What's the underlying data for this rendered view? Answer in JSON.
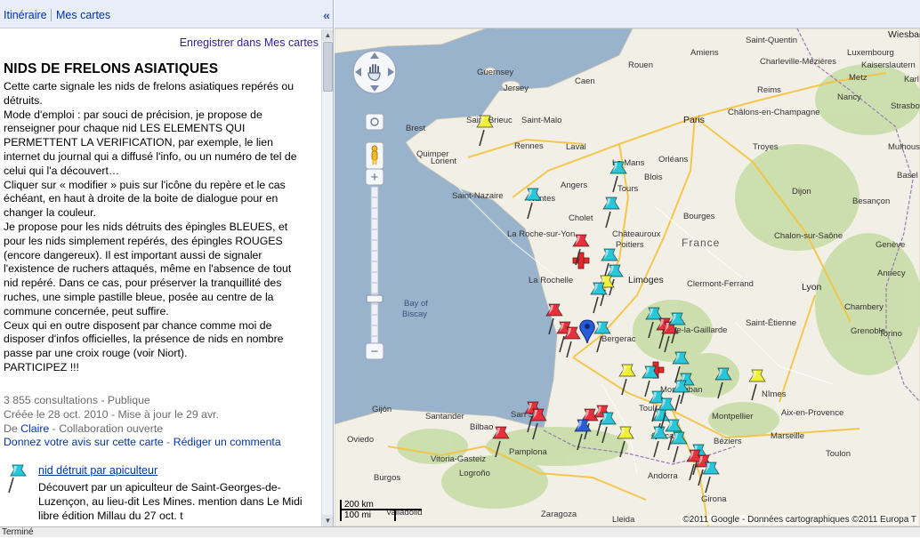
{
  "sidebar": {
    "tabs": [
      {
        "label": "Itinéraire"
      },
      {
        "label": "Mes cartes"
      }
    ],
    "collapse_label": "«",
    "save_label": "Enregistrer dans Mes cartes",
    "title": "NIDS DE FRELONS ASIATIQUES",
    "description": [
      "Cette carte signale les nids de frelons asiatiques repérés ou détruits.",
      "Mode d'emploi : par souci de précision, je propose de renseigner pour chaque nid LES ELEMENTS QUI PERMETTENT LA VERIFICATION, par exemple, le lien internet du journal qui a diffusé l'info, ou un numéro de tel de celui qui l'a découvert…",
      "Cliquer sur « modifier » puis sur l'icône du repère et le cas échéant, en haut à droite de la boite de dialogue pour en changer la couleur.",
      "Je propose pour les nids détruits des épingles BLEUES, et pour les nids simplement repérés, des épingles ROUGES (encore dangereux). Il est important aussi de signaler l'existence de ruchers attaqués, même en l'absence de tout nid repéré. Dans ce cas, pour préserver la tranquillité des ruches, une simple pastille bleue, posée au centre de la commune concernée, peut suffire.",
      "Ceux qui en outre disposent par chance comme moi de disposer d'infos officielles, la présence de nids en nombre passe par une croix rouge (voir Niort).",
      "PARTICIPEZ !!!"
    ],
    "meta": {
      "views": "3 855 consultations - Publique",
      "dates": "Créée le 28 oct. 2010 - Mise à jour le 29 avr.",
      "author_prefix": "De ",
      "author": "Claire",
      "collab": " - Collaboration ouverte",
      "feedback_link": "Donnez votre avis sur cette carte",
      "feedback_sep": " - ",
      "comment_link": "Rédiger un commenta"
    },
    "placemark": {
      "title": "nid détruit par apiculteur",
      "description": "Découvert par un apiculteur de Saint-Georges-de-Luzençon, au lieu-dit Les Mines. mention dans Le Midi libre édition Millau du 27 oct. t"
    }
  },
  "map": {
    "places": {
      "wiesbaden": "Wiesbad",
      "sq": "Saint-Quentin",
      "lux": "Luxembourg",
      "chm": "Charleville-Mézières",
      "kais": "Kaiserslautern",
      "amiens": "Amiens",
      "metz": "Metz",
      "karls": "Karl",
      "guern": "Guernsey",
      "rouen": "Rouen",
      "jersey": "Jersey",
      "caen": "Caen",
      "nancy": "Nancy",
      "stras": "Strasbourg",
      "reims": "Reims",
      "paris": "Paris",
      "chalons": "Châlons-en-Champagne",
      "brest": "Brest",
      "sb": "Saint-Brieuc",
      "sm": "Saint-Malo",
      "rennes": "Rennes",
      "laval": "Laval",
      "troyes": "Troyes",
      "mulh": "Mulhouse",
      "quimper": "Quimper",
      "lorient": "Lorient",
      "lemans": "Le Mans",
      "orleans": "Orléans",
      "basel": "Basel",
      "sn": "Saint-Nazaire",
      "angers": "Angers",
      "tours": "Tours",
      "blois": "Blois",
      "dijon": "Dijon",
      "besancon": "Besançon",
      "nantes": "Nantes",
      "cholet": "Cholet",
      "bourges": "Bourges",
      "lrsy": "La Roche-sur-Yon",
      "chateau": "Châteauroux",
      "chalon": "Chalon-sur-Saône",
      "poitiers": "Poitiers",
      "france": "France",
      "geneve": "Genève",
      "lr": "La Rochelle",
      "limoges": "Limoges",
      "cf": "Clermont-Ferrand",
      "lyon": "Lyon",
      "annecy": "Annecy",
      "bob": "Bay of",
      "biscay": "Biscay",
      "chambery": "Chambery",
      "grenoble": "Grenoble",
      "se": "Saint-Étienne",
      "bergerac": "Bergerac",
      "bg": "Brive-la-Gaillarde",
      "torino": "Torino",
      "mont": "Montauban",
      "gijon": "Gijón",
      "santander": "Santander",
      "nimes": "Nîmes",
      "aix": "Aix-en-Provence",
      "bilbao": "Bilbao",
      "montp": "Montpellier",
      "toul": "Toul",
      "oviedo": "Oviedo",
      "ss": "San Seb",
      "marseille": "Marseille",
      "toulon": "Toulon",
      "pamplona": "Pamplona",
      "vg": "Vitoria-Gasteiz",
      "beziers": "Béziers",
      "carc": "Carcass",
      "burgos": "Burgos",
      "logrono": "Logroño",
      "andorra": "Andorra",
      "girona": "Girona",
      "zaragoza": "Zaragoza",
      "lleida": "Lleida",
      "valla": "Valladolid"
    },
    "pins": [
      {
        "color": "yellow"
      },
      {
        "color": "cyan"
      },
      {
        "color": "cyan"
      },
      {
        "color": "cyan"
      },
      {
        "color": "red"
      },
      {
        "color": "cyan"
      },
      {
        "color": "cyan"
      },
      {
        "color": "yellow"
      },
      {
        "color": "cyan"
      },
      {
        "color": "red"
      },
      {
        "color": "red"
      },
      {
        "color": "red"
      },
      {
        "color": "cyan"
      },
      {
        "color": "cyan"
      },
      {
        "color": "red"
      },
      {
        "color": "red"
      },
      {
        "color": "cyan"
      },
      {
        "color": "cyan"
      },
      {
        "color": "cyan"
      },
      {
        "color": "yellow"
      },
      {
        "color": "cyan"
      },
      {
        "color": "cyan"
      },
      {
        "color": "cyan"
      },
      {
        "color": "yellow"
      },
      {
        "color": "cyan"
      },
      {
        "color": "red"
      },
      {
        "color": "red"
      },
      {
        "color": "red"
      },
      {
        "color": "blue"
      },
      {
        "color": "red"
      },
      {
        "color": "cyan"
      },
      {
        "color": "yellow"
      },
      {
        "color": "cyan"
      },
      {
        "color": "cyan"
      },
      {
        "color": "cyan"
      },
      {
        "color": "cyan"
      },
      {
        "color": "red"
      },
      {
        "color": "red"
      },
      {
        "color": "cyan"
      },
      {
        "color": "red"
      },
      {
        "color": "cyan"
      },
      {
        "color": "cyan"
      }
    ],
    "copyright": "©2011 Google - Données cartographiques ©2011 Europa T",
    "scale_km": "200 km",
    "scale_mi": "100 mi"
  },
  "colors": {
    "sea": "#99b3cc",
    "land": "#f2efe6",
    "pin_red": "#e6303b",
    "pin_cyan": "#27c6d8",
    "pin_yellow": "#eff03a",
    "pin_blue": "#2a5bd8"
  },
  "status": "Terminé"
}
